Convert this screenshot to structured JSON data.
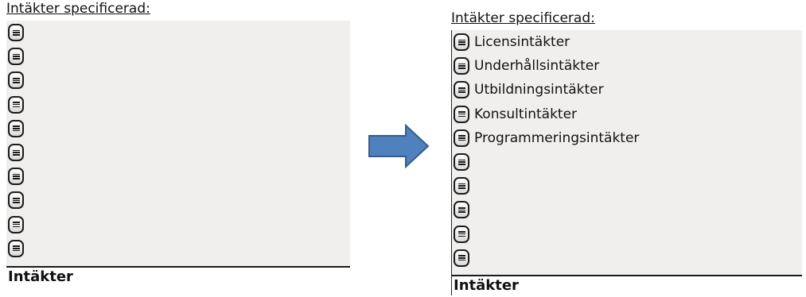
{
  "left": {
    "heading": "Intäkter specificerad:",
    "rows": [
      "",
      "",
      "",
      "",
      "",
      "",
      "",
      "",
      "",
      ""
    ],
    "footer": "Intäkter"
  },
  "right": {
    "heading": "Intäkter specificerad:",
    "rows": [
      "Licensintäkter",
      "Underhållsintäkter",
      "Utbildningsintäkter",
      "Konsultintäkter",
      "Programmeringsintäkter",
      "",
      "",
      "",
      "",
      ""
    ],
    "footer": "Intäkter"
  },
  "colors": {
    "arrow_fill": "#4f81bd",
    "arrow_stroke": "#385d8a",
    "list_bg": "#f0efed"
  },
  "icons": {
    "row_button": "list-icon",
    "arrow": "right-arrow-icon"
  }
}
